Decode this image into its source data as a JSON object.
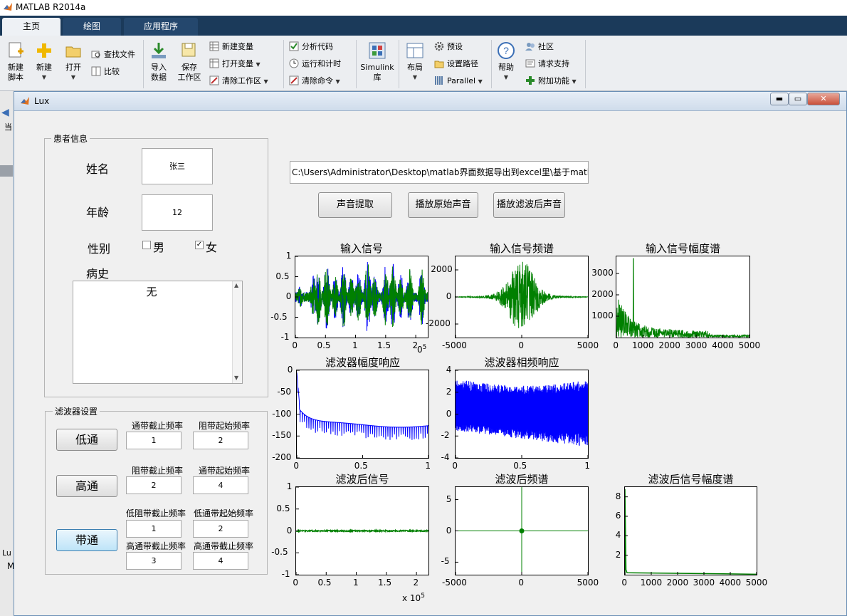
{
  "app": {
    "title": "MATLAB R2014a",
    "tabs": [
      "主页",
      "绘图",
      "应用程序"
    ],
    "ribbon": {
      "new_script": "新建\n脚本",
      "new": "新建",
      "open": "打开",
      "find_files": "查找文件",
      "compare": "比较",
      "import_data": "导入\n数据",
      "save_workspace": "保存\n工作区",
      "new_variable": "新建变量",
      "open_variable": "打开变量",
      "clear_workspace": "清除工作区",
      "analyze_code": "分析代码",
      "run_and_time": "运行和计时",
      "clear_commands": "清除命令",
      "simulink": "Simulink\n库",
      "layout": "布局",
      "preferences": "预设",
      "set_path": "设置路径",
      "parallel": "Parallel",
      "help": "帮助",
      "community": "社区",
      "request_support": "请求支持",
      "add_ons": "附加功能"
    },
    "left_strip_texts": [
      "当",
      "Lu",
      "M"
    ]
  },
  "figure": {
    "title": "Lux",
    "patient_panel": {
      "title": "患者信息",
      "name_label": "姓名",
      "name_value": "张三",
      "age_label": "年龄",
      "age_value": "12",
      "gender_label": "性别",
      "male_label": "男",
      "male_checked": false,
      "female_label": "女",
      "female_checked": true,
      "history_label": "病史",
      "history_value": "无"
    },
    "filter_panel": {
      "title": "滤波器设置",
      "lowpass_button": "低通",
      "highpass_button": "高通",
      "bandpass_button": "带通",
      "lp_pass_cutoff_label": "通带截止频率",
      "lp_pass_cutoff_value": "1",
      "lp_stop_start_label": "阻带起始频率",
      "lp_stop_start_value": "2",
      "hp_stop_cutoff_label": "阻带截止频率",
      "hp_stop_cutoff_value": "2",
      "hp_pass_start_label": "通带起始频率",
      "hp_pass_start_value": "4",
      "bp_low_stop_cutoff_label": "低阻带截止频率",
      "bp_low_stop_cutoff_value": "1",
      "bp_low_pass_start_label": "低通带起始频率",
      "bp_low_pass_start_value": "2",
      "bp_high_pass_cutoff_label": "高通带截止频率",
      "bp_high_pass_cutoff_value": "3",
      "bp_high_stop_cutoff_label": "高通带截止频率",
      "bp_high_stop_cutoff_value": "4"
    },
    "path_field": "C:\\Users\\Administrator\\Desktop\\matlab界面数据导出到excel里\\基于matl",
    "buttons": {
      "extract": "声音提取",
      "play_original": "播放原始声音",
      "play_filtered": "播放滤波后声音"
    },
    "colors": {
      "signal_green": "#008000",
      "signal_blue": "#0000ff"
    }
  },
  "chart_data": [
    {
      "type": "line",
      "title": "输入信号",
      "xlim": [
        0,
        220000
      ],
      "ylim": [
        -1,
        1
      ],
      "xticks": [
        "0",
        "0.5",
        "1",
        "1.5",
        "2"
      ],
      "yticks": [
        "1",
        "0.5",
        "0",
        "-0.5",
        "-1"
      ],
      "x_multiplier": "10^5",
      "series": [
        {
          "color": "#008000"
        },
        {
          "color": "#0000ff"
        }
      ]
    },
    {
      "type": "line",
      "title": "输入信号频谱",
      "xlim": [
        -5000,
        5000
      ],
      "ylim": [
        -3000,
        3000
      ],
      "xticks": [
        "-5000",
        "0",
        "5000"
      ],
      "yticks": [
        "2000",
        "0",
        "-2000"
      ],
      "series": [
        {
          "color": "#008000"
        }
      ]
    },
    {
      "type": "line",
      "title": "输入信号幅度谱",
      "xlim": [
        0,
        5000
      ],
      "ylim": [
        0,
        3800
      ],
      "xticks": [
        "0",
        "1000",
        "2000",
        "3000",
        "4000",
        "5000"
      ],
      "yticks": [
        "3000",
        "2000",
        "1000"
      ],
      "series": [
        {
          "color": "#008000"
        }
      ]
    },
    {
      "type": "line",
      "title": "滤波器幅度响应",
      "xlim": [
        0,
        1
      ],
      "ylim": [
        -200,
        0
      ],
      "xticks": [
        "0",
        "0.5",
        "1"
      ],
      "yticks": [
        "0",
        "-50",
        "-100",
        "-150",
        "-200"
      ],
      "series": [
        {
          "color": "#0000ff"
        }
      ]
    },
    {
      "type": "line",
      "title": "滤波器相频响应",
      "xlim": [
        0,
        1
      ],
      "ylim": [
        -4,
        4
      ],
      "xticks": [
        "0",
        "0.5",
        "1"
      ],
      "yticks": [
        "4",
        "2",
        "0",
        "-2",
        "-4"
      ],
      "series": [
        {
          "color": "#0000ff"
        }
      ]
    },
    {
      "type": "line",
      "title": "滤波后信号",
      "xlim": [
        0,
        220000
      ],
      "ylim": [
        -1,
        1
      ],
      "xticks": [
        "0",
        "0.5",
        "1",
        "1.5",
        "2"
      ],
      "yticks": [
        "1",
        "0.5",
        "0",
        "-0.5",
        "-1"
      ],
      "xlabel": "x 10^5",
      "series": [
        {
          "color": "#008000"
        }
      ]
    },
    {
      "type": "line",
      "title": "滤波后频谱",
      "xlim": [
        -5000,
        5000
      ],
      "ylim": [
        -7,
        7
      ],
      "xticks": [
        "-5000",
        "0",
        "5000"
      ],
      "yticks": [
        "5",
        "0",
        "-5"
      ],
      "series": [
        {
          "color": "#008000"
        }
      ]
    },
    {
      "type": "line",
      "title": "滤波后信号幅度谱",
      "xlim": [
        0,
        5000
      ],
      "ylim": [
        0,
        9
      ],
      "xticks": [
        "0",
        "1000",
        "2000",
        "3000",
        "4000",
        "5000"
      ],
      "yticks": [
        "8",
        "6",
        "4",
        "2"
      ],
      "series": [
        {
          "color": "#008000"
        }
      ]
    }
  ]
}
